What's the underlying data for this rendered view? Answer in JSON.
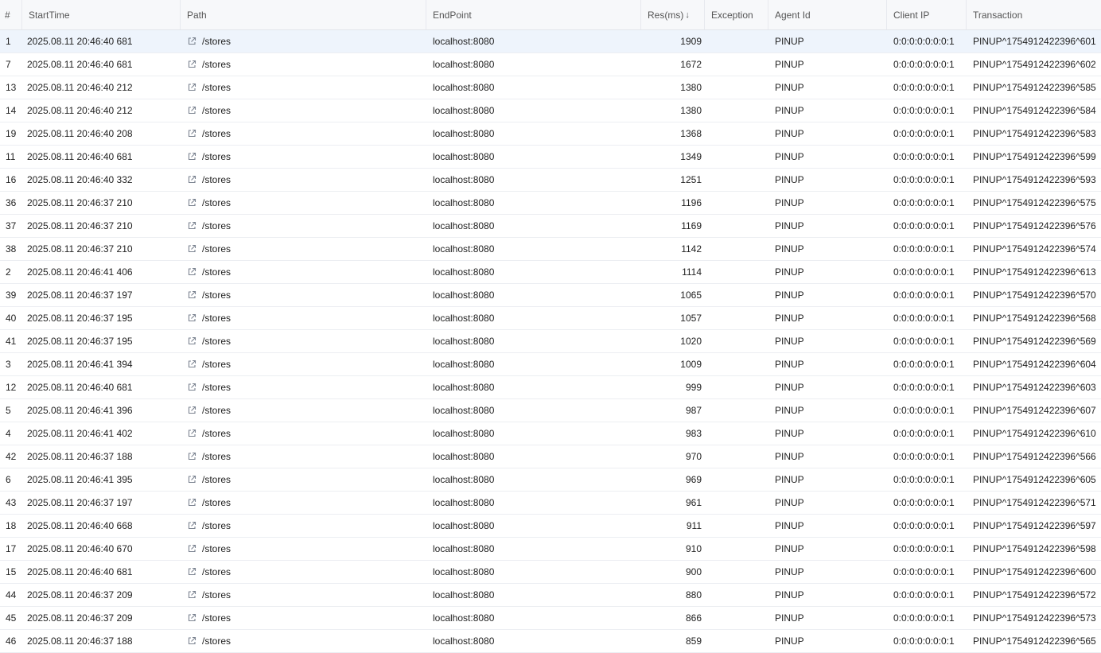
{
  "columns": {
    "index": "#",
    "start_time": "StartTime",
    "path": "Path",
    "endpoint": "EndPoint",
    "res": "Res(ms)",
    "res_sort": "↓",
    "exception": "Exception",
    "agent_id": "Agent Id",
    "client_ip": "Client IP",
    "transaction": "Transaction"
  },
  "icons": {
    "path_link": "external-link-icon"
  },
  "rows": [
    {
      "idx": "1",
      "start": "2025.08.11 20:46:40 681",
      "path": "/stores",
      "endpoint": "localhost:8080",
      "res": "1909",
      "exception": "",
      "agent": "PINUP",
      "ip": "0:0:0:0:0:0:0:1",
      "tx": "PINUP^1754912422396^601"
    },
    {
      "idx": "7",
      "start": "2025.08.11 20:46:40 681",
      "path": "/stores",
      "endpoint": "localhost:8080",
      "res": "1672",
      "exception": "",
      "agent": "PINUP",
      "ip": "0:0:0:0:0:0:0:1",
      "tx": "PINUP^1754912422396^602"
    },
    {
      "idx": "13",
      "start": "2025.08.11 20:46:40 212",
      "path": "/stores",
      "endpoint": "localhost:8080",
      "res": "1380",
      "exception": "",
      "agent": "PINUP",
      "ip": "0:0:0:0:0:0:0:1",
      "tx": "PINUP^1754912422396^585"
    },
    {
      "idx": "14",
      "start": "2025.08.11 20:46:40 212",
      "path": "/stores",
      "endpoint": "localhost:8080",
      "res": "1380",
      "exception": "",
      "agent": "PINUP",
      "ip": "0:0:0:0:0:0:0:1",
      "tx": "PINUP^1754912422396^584"
    },
    {
      "idx": "19",
      "start": "2025.08.11 20:46:40 208",
      "path": "/stores",
      "endpoint": "localhost:8080",
      "res": "1368",
      "exception": "",
      "agent": "PINUP",
      "ip": "0:0:0:0:0:0:0:1",
      "tx": "PINUP^1754912422396^583"
    },
    {
      "idx": "11",
      "start": "2025.08.11 20:46:40 681",
      "path": "/stores",
      "endpoint": "localhost:8080",
      "res": "1349",
      "exception": "",
      "agent": "PINUP",
      "ip": "0:0:0:0:0:0:0:1",
      "tx": "PINUP^1754912422396^599"
    },
    {
      "idx": "16",
      "start": "2025.08.11 20:46:40 332",
      "path": "/stores",
      "endpoint": "localhost:8080",
      "res": "1251",
      "exception": "",
      "agent": "PINUP",
      "ip": "0:0:0:0:0:0:0:1",
      "tx": "PINUP^1754912422396^593"
    },
    {
      "idx": "36",
      "start": "2025.08.11 20:46:37 210",
      "path": "/stores",
      "endpoint": "localhost:8080",
      "res": "1196",
      "exception": "",
      "agent": "PINUP",
      "ip": "0:0:0:0:0:0:0:1",
      "tx": "PINUP^1754912422396^575"
    },
    {
      "idx": "37",
      "start": "2025.08.11 20:46:37 210",
      "path": "/stores",
      "endpoint": "localhost:8080",
      "res": "1169",
      "exception": "",
      "agent": "PINUP",
      "ip": "0:0:0:0:0:0:0:1",
      "tx": "PINUP^1754912422396^576"
    },
    {
      "idx": "38",
      "start": "2025.08.11 20:46:37 210",
      "path": "/stores",
      "endpoint": "localhost:8080",
      "res": "1142",
      "exception": "",
      "agent": "PINUP",
      "ip": "0:0:0:0:0:0:0:1",
      "tx": "PINUP^1754912422396^574"
    },
    {
      "idx": "2",
      "start": "2025.08.11 20:46:41 406",
      "path": "/stores",
      "endpoint": "localhost:8080",
      "res": "1114",
      "exception": "",
      "agent": "PINUP",
      "ip": "0:0:0:0:0:0:0:1",
      "tx": "PINUP^1754912422396^613"
    },
    {
      "idx": "39",
      "start": "2025.08.11 20:46:37 197",
      "path": "/stores",
      "endpoint": "localhost:8080",
      "res": "1065",
      "exception": "",
      "agent": "PINUP",
      "ip": "0:0:0:0:0:0:0:1",
      "tx": "PINUP^1754912422396^570"
    },
    {
      "idx": "40",
      "start": "2025.08.11 20:46:37 195",
      "path": "/stores",
      "endpoint": "localhost:8080",
      "res": "1057",
      "exception": "",
      "agent": "PINUP",
      "ip": "0:0:0:0:0:0:0:1",
      "tx": "PINUP^1754912422396^568"
    },
    {
      "idx": "41",
      "start": "2025.08.11 20:46:37 195",
      "path": "/stores",
      "endpoint": "localhost:8080",
      "res": "1020",
      "exception": "",
      "agent": "PINUP",
      "ip": "0:0:0:0:0:0:0:1",
      "tx": "PINUP^1754912422396^569"
    },
    {
      "idx": "3",
      "start": "2025.08.11 20:46:41 394",
      "path": "/stores",
      "endpoint": "localhost:8080",
      "res": "1009",
      "exception": "",
      "agent": "PINUP",
      "ip": "0:0:0:0:0:0:0:1",
      "tx": "PINUP^1754912422396^604"
    },
    {
      "idx": "12",
      "start": "2025.08.11 20:46:40 681",
      "path": "/stores",
      "endpoint": "localhost:8080",
      "res": "999",
      "exception": "",
      "agent": "PINUP",
      "ip": "0:0:0:0:0:0:0:1",
      "tx": "PINUP^1754912422396^603"
    },
    {
      "idx": "5",
      "start": "2025.08.11 20:46:41 396",
      "path": "/stores",
      "endpoint": "localhost:8080",
      "res": "987",
      "exception": "",
      "agent": "PINUP",
      "ip": "0:0:0:0:0:0:0:1",
      "tx": "PINUP^1754912422396^607"
    },
    {
      "idx": "4",
      "start": "2025.08.11 20:46:41 402",
      "path": "/stores",
      "endpoint": "localhost:8080",
      "res": "983",
      "exception": "",
      "agent": "PINUP",
      "ip": "0:0:0:0:0:0:0:1",
      "tx": "PINUP^1754912422396^610"
    },
    {
      "idx": "42",
      "start": "2025.08.11 20:46:37 188",
      "path": "/stores",
      "endpoint": "localhost:8080",
      "res": "970",
      "exception": "",
      "agent": "PINUP",
      "ip": "0:0:0:0:0:0:0:1",
      "tx": "PINUP^1754912422396^566"
    },
    {
      "idx": "6",
      "start": "2025.08.11 20:46:41 395",
      "path": "/stores",
      "endpoint": "localhost:8080",
      "res": "969",
      "exception": "",
      "agent": "PINUP",
      "ip": "0:0:0:0:0:0:0:1",
      "tx": "PINUP^1754912422396^605"
    },
    {
      "idx": "43",
      "start": "2025.08.11 20:46:37 197",
      "path": "/stores",
      "endpoint": "localhost:8080",
      "res": "961",
      "exception": "",
      "agent": "PINUP",
      "ip": "0:0:0:0:0:0:0:1",
      "tx": "PINUP^1754912422396^571"
    },
    {
      "idx": "18",
      "start": "2025.08.11 20:46:40 668",
      "path": "/stores",
      "endpoint": "localhost:8080",
      "res": "911",
      "exception": "",
      "agent": "PINUP",
      "ip": "0:0:0:0:0:0:0:1",
      "tx": "PINUP^1754912422396^597"
    },
    {
      "idx": "17",
      "start": "2025.08.11 20:46:40 670",
      "path": "/stores",
      "endpoint": "localhost:8080",
      "res": "910",
      "exception": "",
      "agent": "PINUP",
      "ip": "0:0:0:0:0:0:0:1",
      "tx": "PINUP^1754912422396^598"
    },
    {
      "idx": "15",
      "start": "2025.08.11 20:46:40 681",
      "path": "/stores",
      "endpoint": "localhost:8080",
      "res": "900",
      "exception": "",
      "agent": "PINUP",
      "ip": "0:0:0:0:0:0:0:1",
      "tx": "PINUP^1754912422396^600"
    },
    {
      "idx": "44",
      "start": "2025.08.11 20:46:37 209",
      "path": "/stores",
      "endpoint": "localhost:8080",
      "res": "880",
      "exception": "",
      "agent": "PINUP",
      "ip": "0:0:0:0:0:0:0:1",
      "tx": "PINUP^1754912422396^572"
    },
    {
      "idx": "45",
      "start": "2025.08.11 20:46:37 209",
      "path": "/stores",
      "endpoint": "localhost:8080",
      "res": "866",
      "exception": "",
      "agent": "PINUP",
      "ip": "0:0:0:0:0:0:0:1",
      "tx": "PINUP^1754912422396^573"
    },
    {
      "idx": "46",
      "start": "2025.08.11 20:46:37 188",
      "path": "/stores",
      "endpoint": "localhost:8080",
      "res": "859",
      "exception": "",
      "agent": "PINUP",
      "ip": "0:0:0:0:0:0:0:1",
      "tx": "PINUP^1754912422396^565"
    }
  ],
  "selected_row_index": 0,
  "colors": {
    "header_bg": "#f7f8fa",
    "selected_row_bg": "#eef4fc",
    "border": "#eceef2"
  }
}
